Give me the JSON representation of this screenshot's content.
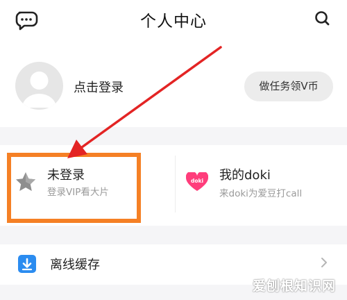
{
  "header": {
    "title": "个人中心",
    "left_icon": "message-icon",
    "right_icon": "search-icon"
  },
  "profile": {
    "login_text": "点击登录",
    "task_button": "做任务领V币",
    "avatar_icon": "default-avatar-icon"
  },
  "vip_card": {
    "title": "未登录",
    "subtitle": "登录VIP看大片",
    "icon": "star-icon",
    "highlight_color": "#f58025"
  },
  "doki_card": {
    "title": "我的doki",
    "subtitle": "来doki为爱豆打call",
    "icon": "doki-heart-icon",
    "icon_text": "doki",
    "icon_color": "#ff3d7b"
  },
  "menu": {
    "cache_label": "离线缓存",
    "cache_icon": "download-icon",
    "cache_icon_color": "#2b8cf0"
  },
  "annotation": {
    "arrow_color": "#e32424"
  },
  "watermark": {
    "text": "爱刨根知识网"
  }
}
